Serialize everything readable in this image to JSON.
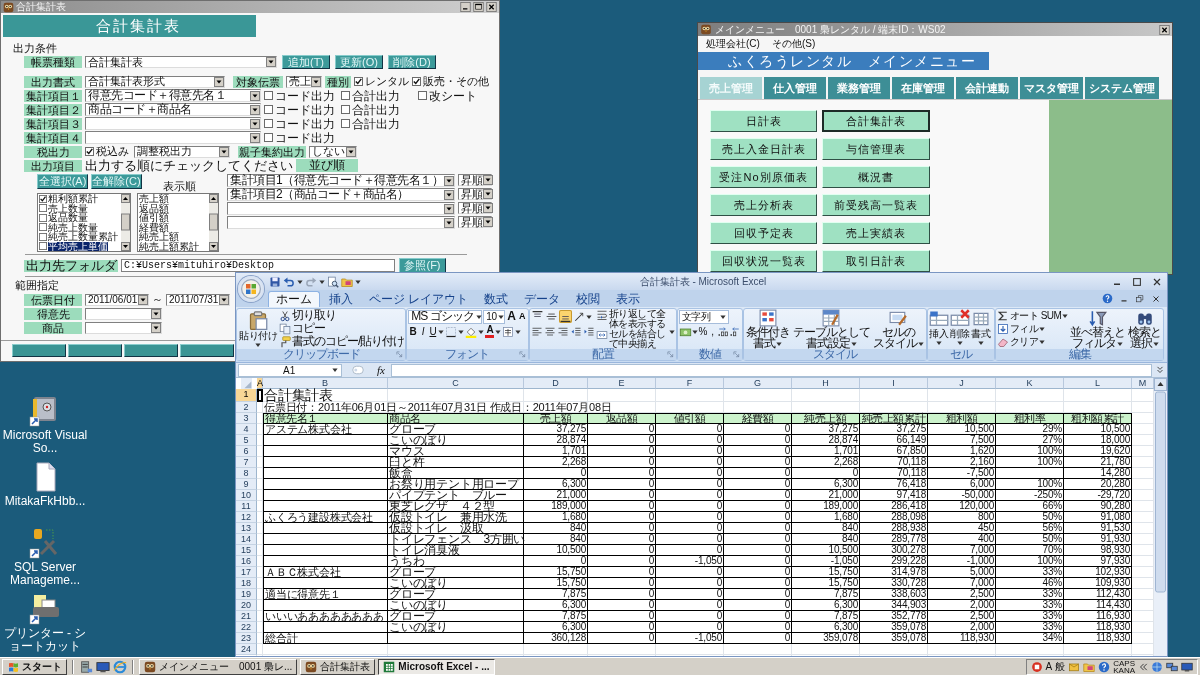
{
  "desktop": {
    "shortcuts": [
      {
        "label": "Microsoft Visual So..."
      },
      {
        "label": "MitakaFkHbb..."
      },
      {
        "label": "SQL Server Manageme..."
      },
      {
        "label": "プリンター - ショートカット"
      }
    ]
  },
  "form_window": {
    "title": "合計集計表",
    "header": "合計集計表",
    "section_output": "出力条件",
    "report_type": {
      "label": "帳票種類",
      "value": "合計集計表"
    },
    "actions": [
      "追加(T)",
      "更新(O)",
      "削除(D)"
    ],
    "format": {
      "label": "出力書式",
      "value": "合計集計表形式"
    },
    "target": {
      "label": "対象伝票",
      "value": "売上"
    },
    "category": {
      "label": "種別",
      "options": [
        {
          "label": "レンタル",
          "checked": true
        },
        {
          "label": "販売・その他",
          "checked": true
        }
      ]
    },
    "aggregates": [
      {
        "label": "集計項目１",
        "value": "得意先コード＋得意先名１",
        "options": [
          {
            "label": "コード出力",
            "checked": false
          },
          {
            "label": "合計出力",
            "checked": false
          },
          {
            "label": "改シート",
            "checked": false
          }
        ]
      },
      {
        "label": "集計項目２",
        "value": "商品コード＋商品名",
        "options": [
          {
            "label": "コード出力",
            "checked": false
          },
          {
            "label": "合計出力",
            "checked": false
          }
        ]
      },
      {
        "label": "集計項目３",
        "options": [
          {
            "label": "コード出力",
            "checked": false
          },
          {
            "label": "合計出力",
            "checked": false
          }
        ]
      },
      {
        "label": "集計項目４",
        "options": [
          {
            "label": "コード出力",
            "checked": false
          }
        ]
      }
    ],
    "tax": {
      "label": "税出力",
      "option": {
        "label": "税込み",
        "checked": true
      },
      "value": "調整税出力"
    },
    "grouping": {
      "label": "親子集約出力",
      "value": "しない"
    },
    "output_items": {
      "label": "出力項目",
      "hint": "出力する順にチェックしてください"
    },
    "sort_label": "並び順",
    "select_buttons": [
      "全選択(A)",
      "全解除(C)"
    ],
    "item_list": [
      {
        "label": "粗利額累計",
        "checked": true,
        "selected": false
      },
      {
        "label": "売上数量",
        "checked": false,
        "selected": false
      },
      {
        "label": "返品数量",
        "checked": false,
        "selected": false
      },
      {
        "label": "純売上数量",
        "checked": false,
        "selected": false
      },
      {
        "label": "純売上数量累計",
        "checked": false,
        "selected": false
      },
      {
        "label": "平均売上単価",
        "checked": false,
        "selected": true
      }
    ],
    "display_order": {
      "label": "表示順",
      "items": [
        {
          "label": "売上額",
          "selected": false
        },
        {
          "label": "返品額",
          "selected": false
        },
        {
          "label": "値引額",
          "selected": false
        },
        {
          "label": "経費額",
          "selected": false
        },
        {
          "label": "純売上額",
          "selected": false
        },
        {
          "label": "純売上額累計",
          "selected": false
        }
      ]
    },
    "sort_rows": [
      {
        "field": "集計項目1（得意先コード＋得意先名１）",
        "order": "昇順"
      },
      {
        "field": "集計項目2（商品コード＋商品名）",
        "order": "昇順"
      },
      {
        "order": "昇順"
      },
      {
        "order": "昇順"
      }
    ],
    "folder": {
      "label": "出力先フォルダ",
      "value": "C:¥Users¥mituhiro¥Desktop",
      "button": "参照(F)"
    },
    "section_range": "範囲指定",
    "date_range": {
      "label": "伝票日付",
      "from": "2011/06/01",
      "separator": "～",
      "to": "2011/07/31"
    },
    "range_fields": [
      {
        "label": "得意先"
      },
      {
        "label": "商品"
      }
    ]
  },
  "menu_window": {
    "title": "メインメニュー　0001 梟レンタル / 端末ID：WS02",
    "menu": [
      "処理会社(C)",
      "その他(S)"
    ],
    "header": "ふくろうレンタル　メインメニュー",
    "tabs": [
      {
        "label": "売上管理",
        "selected": true
      },
      {
        "label": "仕入管理",
        "selected": false
      },
      {
        "label": "業務管理",
        "selected": false
      },
      {
        "label": "在庫管理",
        "selected": false
      },
      {
        "label": "会計連動",
        "selected": false
      },
      {
        "label": "マスタ管理",
        "selected": false
      },
      {
        "label": "システム管理",
        "selected": false
      }
    ],
    "buttons": [
      {
        "label": "日計表",
        "focused": false
      },
      {
        "label": "合計集計表",
        "focused": true
      },
      {
        "label": "売上入金日計表",
        "focused": false
      },
      {
        "label": "与信管理表",
        "focused": false
      },
      {
        "label": "受注No別原価表",
        "focused": false
      },
      {
        "label": "概況書",
        "focused": false
      },
      {
        "label": "売上分析表",
        "focused": false
      },
      {
        "label": "前受残高一覧表",
        "focused": false
      },
      {
        "label": "回収予定表",
        "focused": false
      },
      {
        "label": "売上実績表",
        "focused": false
      },
      {
        "label": "回収状況一覧表",
        "focused": false
      },
      {
        "label": "取引日計表",
        "focused": false
      }
    ]
  },
  "excel_window": {
    "title": "合計集計表 - Microsoft Excel",
    "tabs": [
      {
        "label": "ホーム",
        "selected": true
      },
      {
        "label": "挿入",
        "selected": false
      },
      {
        "label": "ページ レイアウト",
        "selected": false
      },
      {
        "label": "数式",
        "selected": false
      },
      {
        "label": "データ",
        "selected": false
      },
      {
        "label": "校閲",
        "selected": false
      },
      {
        "label": "表示",
        "selected": false
      }
    ],
    "ribbon": {
      "clipboard": {
        "label": "クリップボード",
        "paste": "貼り付け",
        "cut": "切り取り",
        "copy": "コピー",
        "format_painter": "書式のコピー/貼り付け"
      },
      "font": {
        "label": "フォント",
        "name": "MS ゴシック",
        "size": "10",
        "grow": "A",
        "shrink": "A",
        "bold": "B",
        "italic": "I",
        "underline": "U",
        "tint_button": "A"
      },
      "alignment": {
        "label": "配置",
        "vertical": [
          {
            "on": false
          },
          {
            "on": false
          },
          {
            "on": true
          }
        ],
        "wrap": "折り返して全体を表示する",
        "merge": "セルを結合して中央揃え"
      },
      "number": {
        "label": "数値",
        "format": "文字列",
        "percent": "%",
        "comma": ","
      },
      "styles": {
        "label": "スタイル",
        "buttons": [
          {
            "lines": [
              "条件付き",
              "書式"
            ]
          },
          {
            "lines": [
              "テーブルとして",
              "書式設定"
            ]
          },
          {
            "lines": [
              "セルの",
              "スタイル"
            ]
          }
        ]
      },
      "cells": {
        "label": "セル",
        "buttons": [
          "挿入",
          "削除",
          "書式"
        ]
      },
      "editing": {
        "label": "編集",
        "autosum": "オート SUM",
        "fill": "フィル",
        "clear": "クリア",
        "sort": {
          "lines": [
            "並べ替えと",
            "フィルタ"
          ]
        },
        "find": {
          "lines": [
            "検索と",
            "選択"
          ]
        }
      }
    },
    "name_box": "A1",
    "function_button": "fx",
    "sheet": {
      "columns": [
        {
          "name": "A",
          "selected": true
        },
        {
          "name": "B",
          "selected": false
        },
        {
          "name": "C",
          "selected": false
        },
        {
          "name": "D",
          "selected": false
        },
        {
          "name": "E",
          "selected": false
        },
        {
          "name": "F",
          "selected": false
        },
        {
          "name": "G",
          "selected": false
        },
        {
          "name": "H",
          "selected": false
        },
        {
          "name": "I",
          "selected": false
        },
        {
          "name": "J",
          "selected": false
        },
        {
          "name": "K",
          "selected": false
        },
        {
          "name": "L",
          "selected": false
        },
        {
          "name": "M",
          "selected": false
        }
      ],
      "rows": [
        {
          "row": "1",
          "selected": true,
          "kind": "title",
          "B": "合計集計表"
        },
        {
          "row": "2",
          "selected": false,
          "kind": "note",
          "B": "伝票日付：2011年06月01日～2011年07月31日 作成日：2011年07月08日"
        },
        {
          "row": "3",
          "selected": false,
          "kind": "header",
          "B": "得意先名１",
          "C": "商品名",
          "D": "売上額",
          "E": "返品額",
          "F": "値引額",
          "G": "経費額",
          "H": "純売上額",
          "I": "純売上額累計",
          "J": "粗利額",
          "K": "粗利率",
          "L": "粗利額累計"
        },
        {
          "row": "4",
          "selected": false,
          "kind": "data",
          "B": "アステム株式会社",
          "C": "グローブ",
          "D": "37,275",
          "E": "0",
          "F": "0",
          "G": "0",
          "H": "37,275",
          "I": "37,275",
          "J": "10,500",
          "K": "29%",
          "L": "10,500"
        },
        {
          "row": "5",
          "selected": false,
          "kind": "data",
          "C": "こいのぼり",
          "D": "28,874",
          "E": "0",
          "F": "0",
          "G": "0",
          "H": "28,874",
          "I": "66,149",
          "J": "7,500",
          "K": "27%",
          "L": "18,000"
        },
        {
          "row": "6",
          "selected": false,
          "kind": "data",
          "C": "マウス",
          "D": "1,701",
          "E": "0",
          "F": "0",
          "G": "0",
          "H": "1,701",
          "I": "67,850",
          "J": "1,620",
          "K": "100%",
          "L": "19,620"
        },
        {
          "row": "7",
          "selected": false,
          "kind": "data",
          "C": "臼と杵",
          "D": "2,268",
          "E": "0",
          "F": "0",
          "G": "0",
          "H": "2,268",
          "I": "70,118",
          "J": "2,160",
          "K": "100%",
          "L": "21,780"
        },
        {
          "row": "8",
          "selected": false,
          "kind": "data",
          "C": "飯盒",
          "D": "0",
          "E": "0",
          "F": "0",
          "G": "0",
          "H": "0",
          "I": "70,118",
          "J": "-7,500",
          "L": "14,280"
        },
        {
          "row": "9",
          "selected": false,
          "kind": "data",
          "C": "お祭り用テント用ロープ",
          "D": "6,300",
          "E": "0",
          "F": "0",
          "G": "0",
          "H": "6,300",
          "I": "76,418",
          "J": "6,000",
          "K": "100%",
          "L": "20,280"
        },
        {
          "row": "10",
          "selected": false,
          "kind": "data",
          "C": "パイプテント　ブルー",
          "D": "21,000",
          "E": "0",
          "F": "0",
          "G": "0",
          "H": "21,000",
          "I": "97,418",
          "J": "-50,000",
          "K": "-250%",
          "L": "-29,720"
        },
        {
          "row": "11",
          "selected": false,
          "kind": "data",
          "C": "東芝レグザ　４２型",
          "D": "189,000",
          "E": "0",
          "F": "0",
          "G": "0",
          "H": "189,000",
          "I": "286,418",
          "J": "120,000",
          "K": "66%",
          "L": "90,280"
        },
        {
          "row": "12",
          "selected": false,
          "kind": "data",
          "B": "ふくろう建設株式会社",
          "C": "仮設トイレ　兼用水洗",
          "D": "1,680",
          "E": "0",
          "F": "0",
          "G": "0",
          "H": "1,680",
          "I": "288,098",
          "J": "800",
          "K": "50%",
          "L": "91,080"
        },
        {
          "row": "13",
          "selected": false,
          "kind": "data",
          "C": "仮設トイレ　汲取",
          "D": "840",
          "E": "0",
          "F": "0",
          "G": "0",
          "H": "840",
          "I": "288,938",
          "J": "450",
          "K": "56%",
          "L": "91,530"
        },
        {
          "row": "14",
          "selected": false,
          "kind": "data",
          "C": "トイレフェンス　3方囲い",
          "D": "840",
          "E": "0",
          "F": "0",
          "G": "0",
          "H": "840",
          "I": "289,778",
          "J": "400",
          "K": "50%",
          "L": "91,930"
        },
        {
          "row": "15",
          "selected": false,
          "kind": "data",
          "C": "トイレ消臭液",
          "D": "10,500",
          "E": "0",
          "F": "0",
          "G": "0",
          "H": "10,500",
          "I": "300,278",
          "J": "7,000",
          "K": "70%",
          "L": "98,930"
        },
        {
          "row": "16",
          "selected": false,
          "kind": "data",
          "C": "うちわ",
          "D": "0",
          "E": "0",
          "F": "-1,050",
          "G": "0",
          "H": "-1,050",
          "I": "299,228",
          "J": "-1,000",
          "K": "100%",
          "L": "97,930"
        },
        {
          "row": "17",
          "selected": false,
          "kind": "data",
          "B": "ＡＢＣ株式会社",
          "C": "グローブ",
          "D": "15,750",
          "E": "0",
          "F": "0",
          "G": "0",
          "H": "15,750",
          "I": "314,978",
          "J": "5,000",
          "K": "33%",
          "L": "102,930"
        },
        {
          "row": "18",
          "selected": false,
          "kind": "data",
          "C": "こいのぼり",
          "D": "15,750",
          "E": "0",
          "F": "0",
          "G": "0",
          "H": "15,750",
          "I": "330,728",
          "J": "7,000",
          "K": "46%",
          "L": "109,930"
        },
        {
          "row": "19",
          "selected": false,
          "kind": "data",
          "B": "適当に得意先１",
          "C": "グローブ",
          "D": "7,875",
          "E": "0",
          "F": "0",
          "G": "0",
          "H": "7,875",
          "I": "338,603",
          "J": "2,500",
          "K": "33%",
          "L": "112,430"
        },
        {
          "row": "20",
          "selected": false,
          "kind": "data",
          "C": "こいのぼり",
          "D": "6,300",
          "E": "0",
          "F": "0",
          "G": "0",
          "H": "6,300",
          "I": "344,903",
          "J": "2,000",
          "K": "33%",
          "L": "114,430"
        },
        {
          "row": "21",
          "selected": false,
          "kind": "data",
          "B": "いいいああああああああ",
          "C": "グローブ",
          "D": "7,875",
          "E": "0",
          "F": "0",
          "G": "0",
          "H": "7,875",
          "I": "352,778",
          "J": "2,500",
          "K": "33%",
          "L": "116,930"
        },
        {
          "row": "22",
          "selected": false,
          "kind": "data",
          "C": "こいのぼり",
          "D": "6,300",
          "E": "0",
          "F": "0",
          "G": "0",
          "H": "6,300",
          "I": "359,078",
          "J": "2,000",
          "K": "33%",
          "L": "118,930"
        },
        {
          "row": "23",
          "selected": false,
          "kind": "data",
          "B": "総合計",
          "D": "360,128",
          "E": "0",
          "F": "-1,050",
          "G": "0",
          "H": "359,078",
          "I": "359,078",
          "J": "118,930",
          "K": "34%",
          "L": "118,930"
        },
        {
          "row": "24",
          "selected": false,
          "kind": "blank"
        }
      ]
    }
  },
  "taskbar": {
    "start": "スタート",
    "tasks": [
      {
        "label": "メインメニュー　0001 梟レ...",
        "kind": "app",
        "selected": false
      },
      {
        "label": "合計集計表",
        "kind": "app",
        "selected": false
      },
      {
        "label": "Microsoft Excel - ...",
        "kind": "excel",
        "selected": true
      }
    ],
    "ime": [
      "A",
      "般"
    ],
    "keys": [
      "CAPS",
      "KANA"
    ]
  }
}
